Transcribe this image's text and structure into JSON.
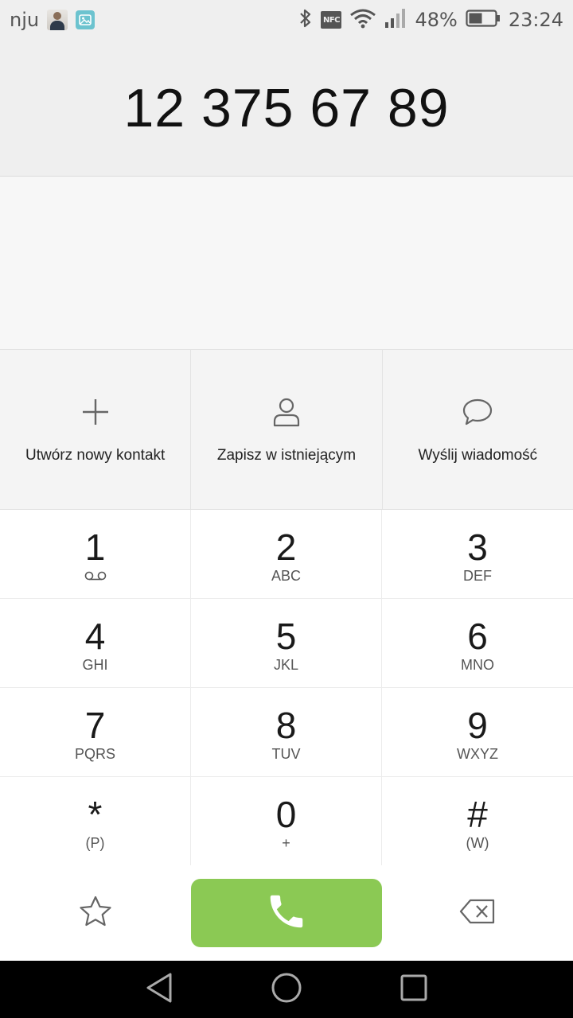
{
  "status_bar": {
    "carrier": "nju",
    "battery_percent": "48%",
    "time": "23:24",
    "nfc_label": "NFC",
    "icons": [
      "photo-notification-icon",
      "gallery-icon",
      "bluetooth-icon",
      "nfc-icon",
      "wifi-icon",
      "signal-icon",
      "battery-icon"
    ]
  },
  "display": {
    "number": "12 375 67 89"
  },
  "actions": [
    {
      "label": "Utwórz nowy kontakt",
      "icon": "plus-icon"
    },
    {
      "label": "Zapisz w istniejącym",
      "icon": "person-icon"
    },
    {
      "label": "Wyślij wiadomość",
      "icon": "message-icon"
    }
  ],
  "keypad": [
    {
      "digit": "1",
      "sub": ""
    },
    {
      "digit": "2",
      "sub": "ABC"
    },
    {
      "digit": "3",
      "sub": "DEF"
    },
    {
      "digit": "4",
      "sub": "GHI"
    },
    {
      "digit": "5",
      "sub": "JKL"
    },
    {
      "digit": "6",
      "sub": "MNO"
    },
    {
      "digit": "7",
      "sub": "PQRS"
    },
    {
      "digit": "8",
      "sub": "TUV"
    },
    {
      "digit": "9",
      "sub": "WXYZ"
    },
    {
      "digit": "*",
      "sub": "(P)"
    },
    {
      "digit": "0",
      "sub": "+"
    },
    {
      "digit": "#",
      "sub": "(W)"
    }
  ],
  "bottom_bar": {
    "icons": [
      "star-icon",
      "phone-icon",
      "backspace-icon"
    ],
    "call_color": "#8bc954"
  },
  "nav_bar": {
    "icons": [
      "back-icon",
      "home-icon",
      "recents-icon"
    ]
  }
}
